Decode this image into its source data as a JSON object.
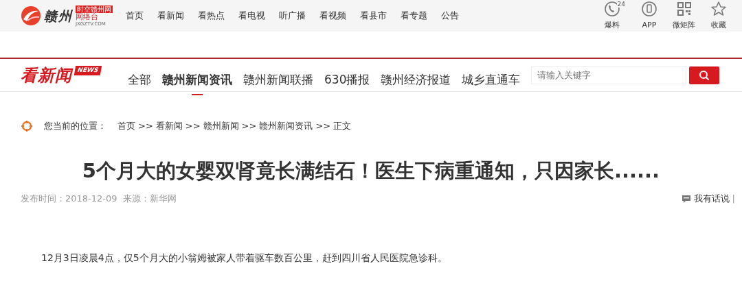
{
  "site_logo": {
    "name": "赣州",
    "tag": "时空赣州网",
    "subtitle": "网络台",
    "domain": "JXGZTV.COM"
  },
  "top_nav": [
    {
      "label": "首页"
    },
    {
      "label": "看新闻"
    },
    {
      "label": "看热点"
    },
    {
      "label": "看电视"
    },
    {
      "label": "听广播"
    },
    {
      "label": "看视频"
    },
    {
      "label": "看县市"
    },
    {
      "label": "看专题"
    },
    {
      "label": "公告"
    }
  ],
  "top_tools": [
    {
      "kind": "phone",
      "label": "爆料",
      "badge": "24"
    },
    {
      "kind": "mobile",
      "label": "APP"
    },
    {
      "kind": "qr",
      "label": "微矩阵"
    },
    {
      "kind": "star",
      "label": "收藏"
    }
  ],
  "section_logo": {
    "title": "看新闻",
    "tag": "NEWS"
  },
  "section_nav": [
    {
      "label": "全部",
      "selected": false
    },
    {
      "label": "赣州新闻资讯",
      "selected": true
    },
    {
      "label": "赣州新闻联播",
      "selected": false
    },
    {
      "label": "630播报",
      "selected": false
    },
    {
      "label": "赣州经济报道",
      "selected": false
    },
    {
      "label": "城乡直通车",
      "selected": false
    }
  ],
  "search": {
    "placeholder": "请输入关键字"
  },
  "breadcrumb": {
    "label": "您当前的位置：",
    "separator": ">>",
    "items": [
      "首页",
      "看新闻",
      "赣州新闻",
      "赣州新闻资讯",
      "正文"
    ]
  },
  "article": {
    "title": "5个月大的女婴双肾竟长满结石！医生下病重通知，只因家长......",
    "published": "发布时间：2018-12-09",
    "source": "来源：新华网",
    "comment_link": "我有话说",
    "divider": "|",
    "paragraphs": [
      "12月3日凌晨4点，仅5个月大的小翁姆被家人带着驱车数百公里，赶到四川省人民医院急诊科。"
    ]
  }
}
